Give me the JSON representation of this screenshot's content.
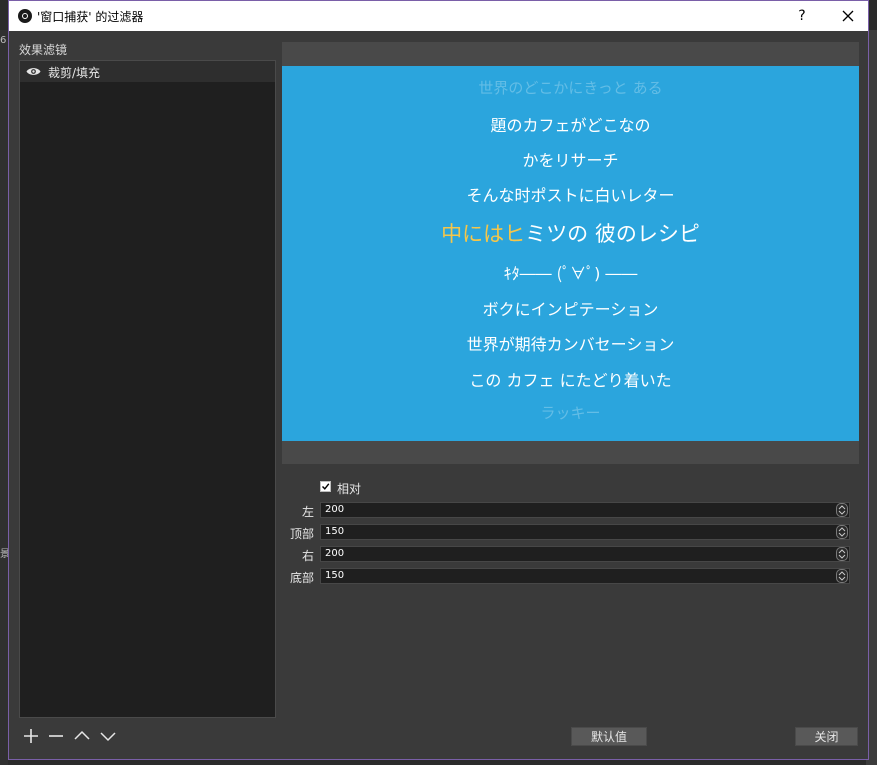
{
  "window": {
    "title": "'窗口捕获' 的过滤器",
    "help_label": "?"
  },
  "background_fragments": {
    "left_top": "6",
    "left_mid": "景"
  },
  "sidebar": {
    "title": "效果滤镜",
    "items": [
      {
        "label": "裁剪/填充",
        "visible_icon": "eye-icon"
      }
    ],
    "tools": [
      "plus-icon",
      "minus-icon",
      "chevron-up-icon",
      "chevron-down-icon"
    ]
  },
  "preview": {
    "background_color": "#2ba5dd",
    "lines": {
      "l1": "世界のどこかにきっと ある",
      "l2": "題のカフェがどこなの",
      "l3": "かをリサーチ",
      "l4": "そんな时ポストに白いレター",
      "l5_highlight": "中にはヒ",
      "l5_rest": "ミツの 彼のレシピ",
      "l6": "ｷﾀ―― (ﾟ∀ﾟ) ――",
      "l7": "ボクにインピテーション",
      "l8": "世界が期待カンバセーション",
      "l9": "この カフェ にたどり着いた",
      "l10": "ラッキー"
    }
  },
  "properties": {
    "relative": {
      "label": "相对",
      "checked": true
    },
    "left": {
      "label": "左",
      "value": "200"
    },
    "top": {
      "label": "顶部",
      "value": "150"
    },
    "right": {
      "label": "右",
      "value": "200"
    },
    "bottom": {
      "label": "底部",
      "value": "150"
    }
  },
  "buttons": {
    "defaults": "默认值",
    "close": "关闭"
  }
}
